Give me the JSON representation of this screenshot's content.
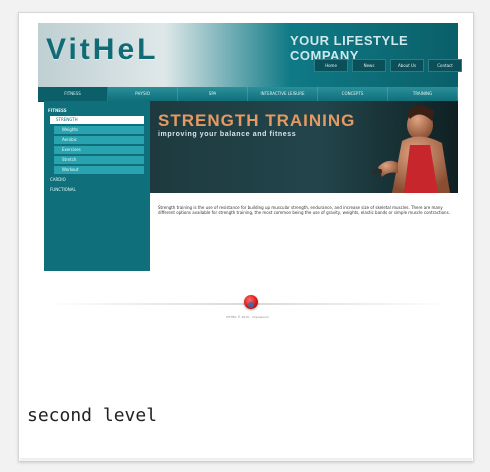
{
  "site": {
    "logo": "VitHeL",
    "tagline": "YOUR LIFESTYLE COMPANY",
    "top_links": [
      "Home",
      "News",
      "About Us",
      "Contact"
    ],
    "nav": [
      "FITNESS",
      "PHYSIO",
      "SPA",
      "INTERACTIVE LEISURE",
      "CONCEPTS",
      "TRAINING"
    ],
    "sidebar": {
      "heading": "FITNESS",
      "items": [
        {
          "label": "STRENGTH",
          "selected": true
        },
        {
          "label": "Weights"
        },
        {
          "label": "Aerobic"
        },
        {
          "label": "Exercises"
        },
        {
          "label": "Stretch"
        },
        {
          "label": "Workout"
        }
      ],
      "extra_items": [
        "CARDIO",
        "FUNCTIONAL"
      ]
    },
    "banner": {
      "title": "STRENGTH TRAINING",
      "subtitle": "improving your balance and fitness"
    },
    "content": "Strength training is the use of resistance for building up muscular strength, endurance, and increase size of skeletal muscles. There are many different options available for strength training, the most common being the use of gravity, weights, elastic bands or simple muscle contractions.",
    "footer": "VITHEL © 2010 - impressum"
  },
  "caption": "second level",
  "colors": {
    "teal": "#0f6f7a",
    "light_teal": "#2aa3b1",
    "banner_orange": "#e49a62",
    "red": "#d71b1b"
  }
}
